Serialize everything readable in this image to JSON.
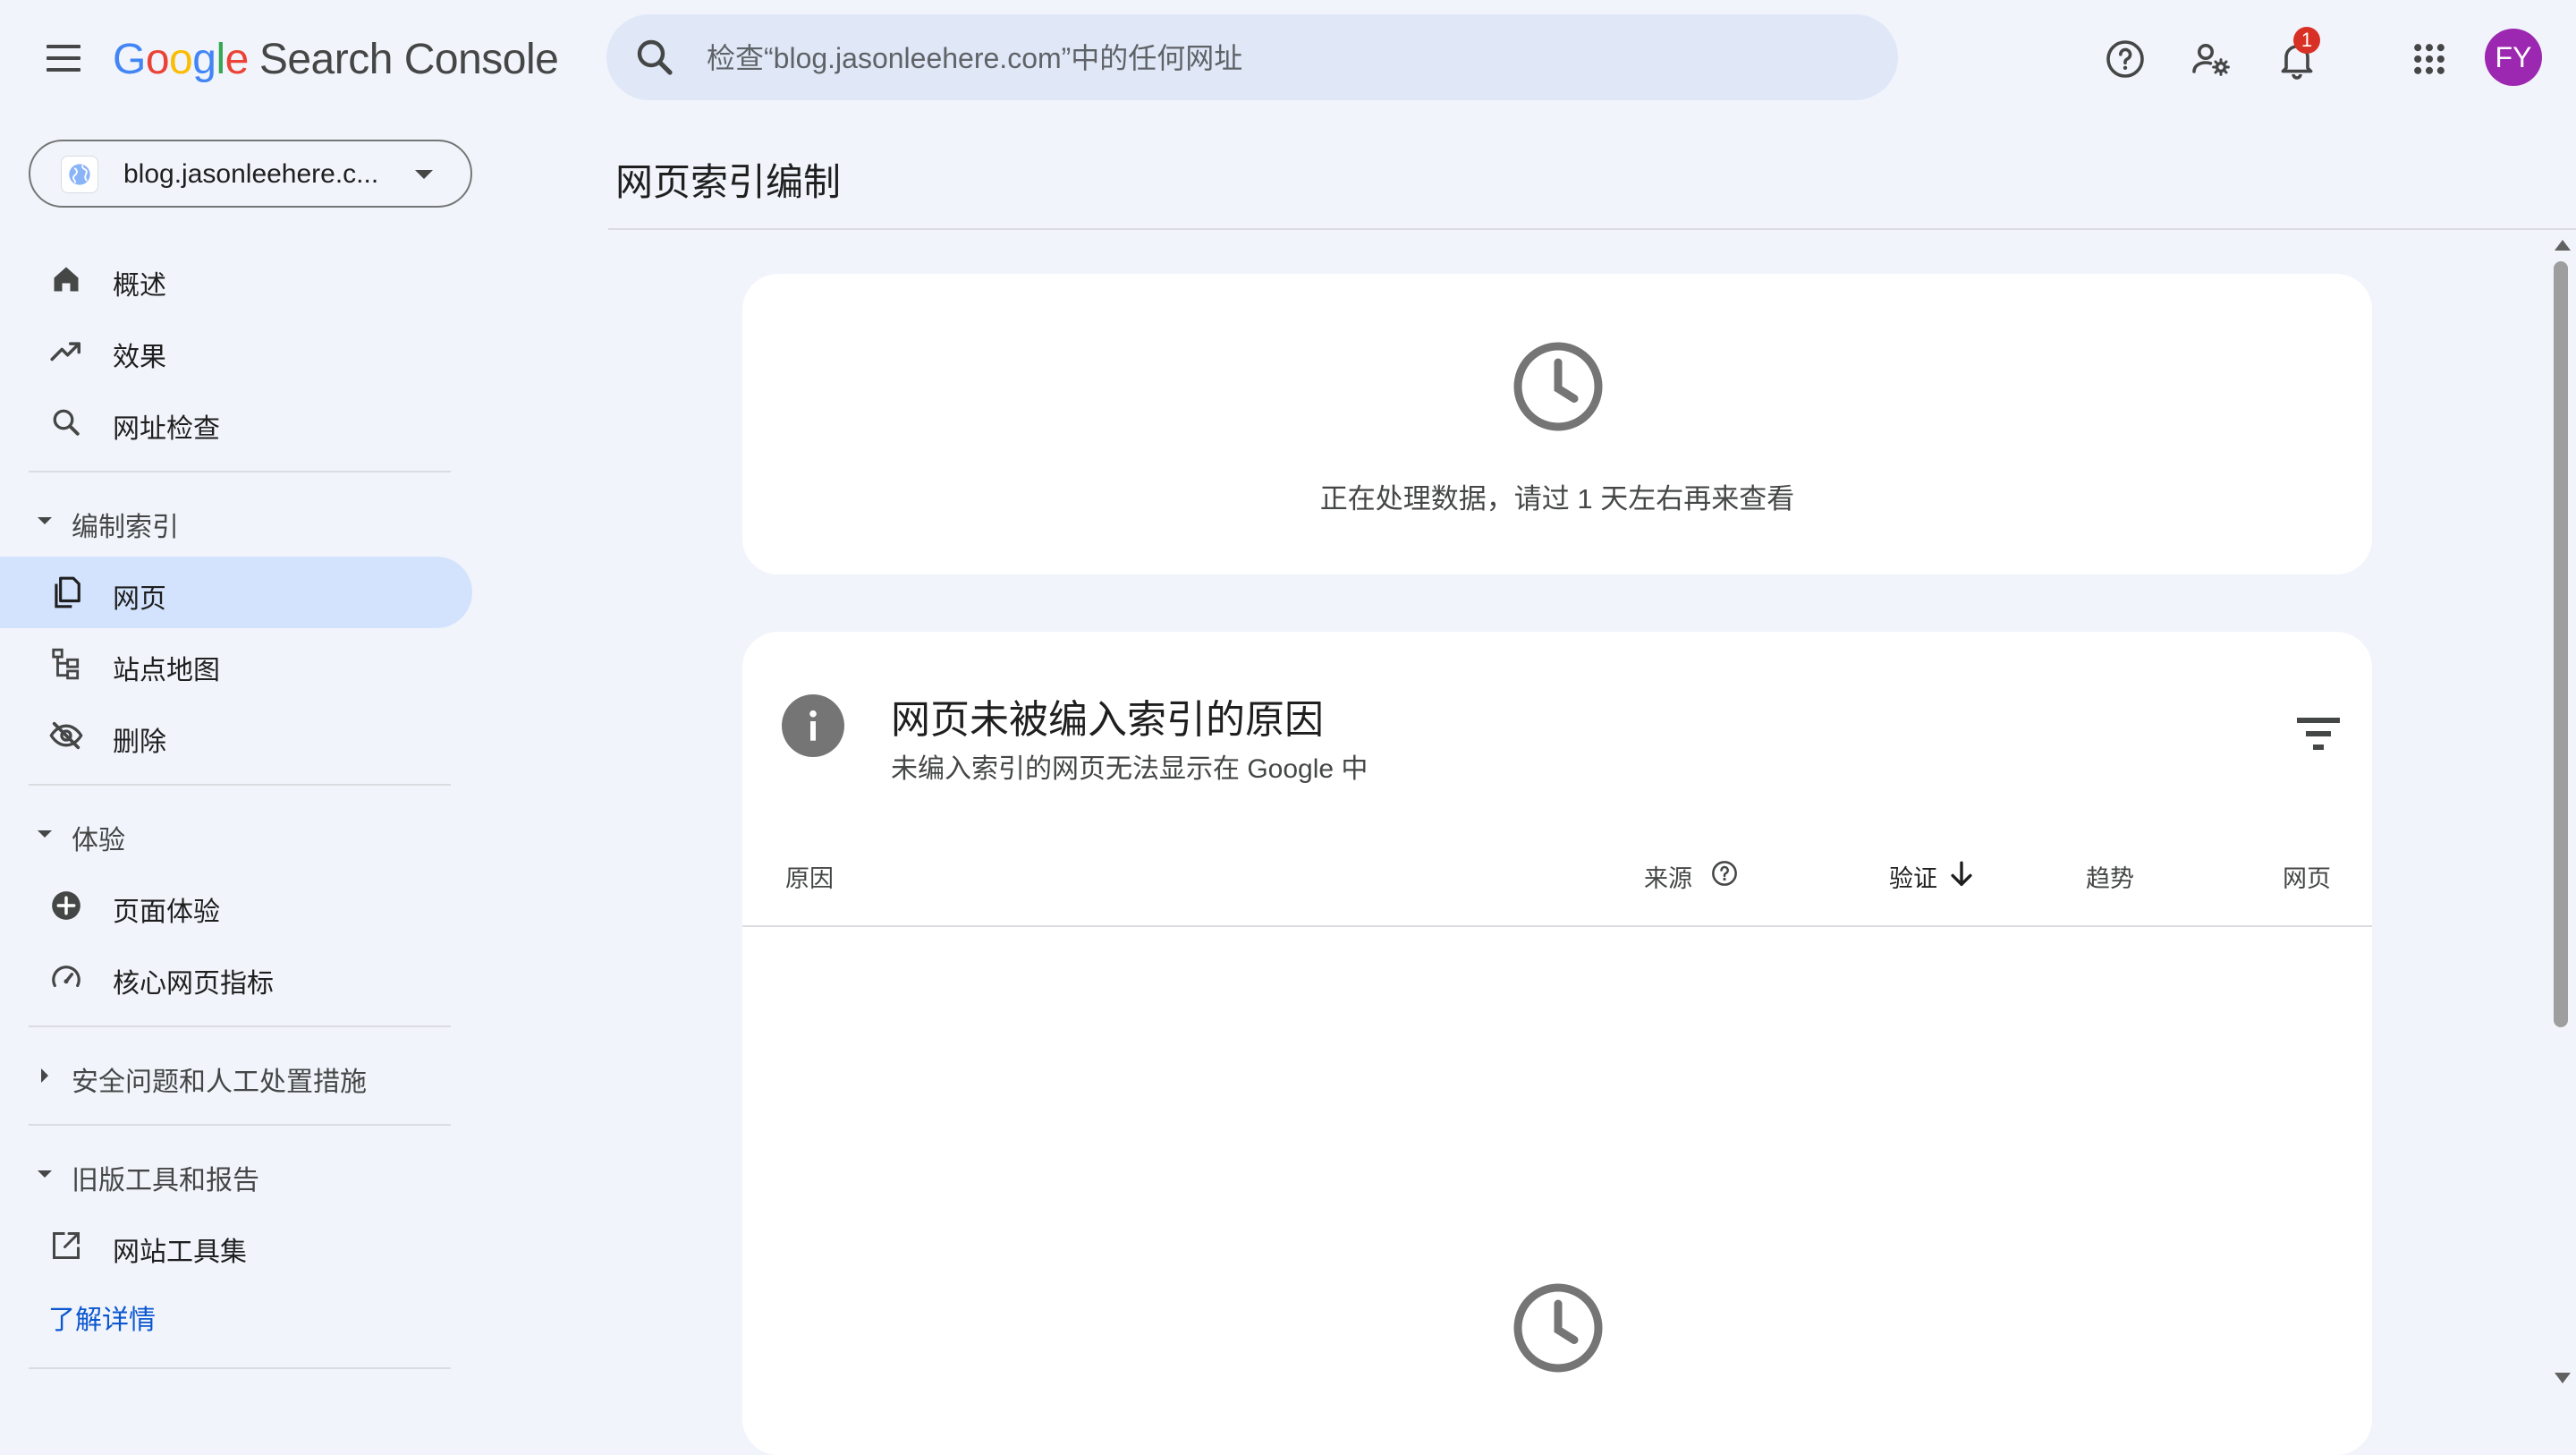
{
  "app": {
    "logo": {
      "g1": "G",
      "g2": "o",
      "g3": "o",
      "g4": "g",
      "g5": "l",
      "g6": "e",
      "product": "Search Console"
    },
    "avatar_initials": "FY",
    "notification_count": "1",
    "avatar_color": "#9c27b0"
  },
  "search": {
    "placeholder": "检查“blog.jasonleehere.com”中的任何网址"
  },
  "sidebar": {
    "property": "blog.jasonleehere.c...",
    "items_top": [
      {
        "label": "概述",
        "icon": "home-icon"
      },
      {
        "label": "效果",
        "icon": "trending-up-icon"
      },
      {
        "label": "网址检查",
        "icon": "search-icon"
      }
    ],
    "section_indexing": {
      "label": "编制索引",
      "items": [
        {
          "label": "网页",
          "icon": "pages-icon",
          "active": true
        },
        {
          "label": "站点地图",
          "icon": "sitemap-icon"
        },
        {
          "label": "删除",
          "icon": "visibility-off-icon"
        }
      ]
    },
    "section_experience": {
      "label": "体验",
      "items": [
        {
          "label": "页面体验",
          "icon": "page-experience-icon"
        },
        {
          "label": "核心网页指标",
          "icon": "speedometer-icon"
        }
      ]
    },
    "section_security": {
      "label": "安全问题和人工处置措施"
    },
    "section_legacy": {
      "label": "旧版工具和报告",
      "items": [
        {
          "label": "网站工具集",
          "icon": "open-in-new-icon"
        }
      ]
    },
    "learn_more": "了解详情"
  },
  "main": {
    "page_title": "网页索引编制",
    "processing_card": {
      "message": "正在处理数据，请过 1 天左右再来查看"
    },
    "reasons_card": {
      "title": "网页未被编入索引的原因",
      "subtitle": "未编入索引的网页无法显示在 Google 中",
      "columns": {
        "reason": "原因",
        "source": "来源",
        "validation": "验证",
        "trend": "趋势",
        "pages": "网页"
      }
    }
  },
  "colors": {
    "accent_blue": "#0b57d0",
    "active_nav_bg": "#d3e3fd",
    "background": "#f1f4fb"
  }
}
